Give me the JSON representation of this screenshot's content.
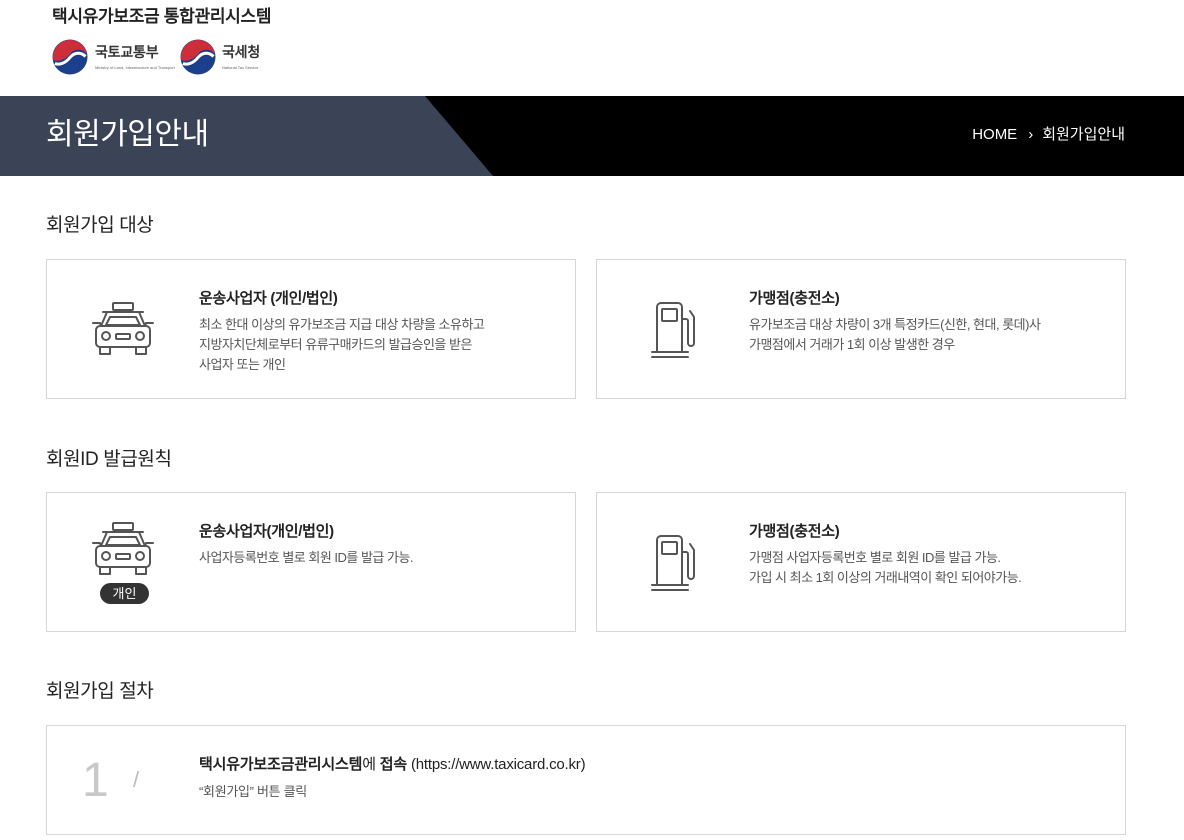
{
  "theme": {
    "banner_left": "#3b4456",
    "banner_right": "#000000",
    "badge_bg": "#333333",
    "card_border": "#d6d6d6",
    "emblem_red": "#cd2e3a",
    "emblem_blue": "#1c3f8c"
  },
  "header": {
    "system_title": "택시유가보조금 통합관리시스템",
    "logos": [
      {
        "name": "국토교통부",
        "subtitle": "Ministry of Land, Infrastructure and Transport",
        "icon": "government-emblem-icon"
      },
      {
        "name": "국세청",
        "subtitle": "National Tax Service",
        "icon": "government-emblem-icon"
      }
    ]
  },
  "banner": {
    "title": "회원가입안내",
    "breadcrumb": {
      "home": "HOME",
      "separator": "›",
      "current": "회원가입안내"
    }
  },
  "eligibility": {
    "heading": "회원가입 대상",
    "cards": [
      {
        "icon": "taxi-icon",
        "title": "운송사업자 (개인/법인)",
        "desc": [
          "최소 한대 이상의 유가보조금 지급 대상 차량을 소유하고",
          "지방자치단체로부터 유류구매카드의 발급승인을 받은",
          "사업자 또는 개인"
        ]
      },
      {
        "icon": "fuel-pump-icon",
        "title": "가맹점(충전소)",
        "desc": [
          "유가보조금 대상 차량이 3개 특정카드(신한, 현대, 롯데)사",
          "가맹점에서 거래가 1회 이상 발생한 경우"
        ]
      }
    ]
  },
  "id_policy": {
    "heading": "회원ID 발급원칙",
    "cards": [
      {
        "icon": "taxi-icon",
        "badge": "개인",
        "title": "운송사업자(개인/법인)",
        "desc": [
          "사업자등록번호 별로 회원 ID를 발급 가능."
        ]
      },
      {
        "icon": "fuel-pump-icon",
        "title": "가맹점(충전소)",
        "desc": [
          "가맹점 사업자등록번호 별로 회원 ID를 발급 가능.",
          "가입 시 최소 1회 이상의 거래내역이 확인 되어야가능."
        ]
      }
    ]
  },
  "procedure": {
    "heading": "회원가입 절차",
    "steps": [
      {
        "number": "1",
        "separator": "/",
        "title_parts": [
          "택시유가보조금관리시스템",
          "에 ",
          "접속",
          " (https://www.taxicard.co.kr)"
        ],
        "desc": "“회원가입” 버튼 클릭"
      }
    ]
  }
}
